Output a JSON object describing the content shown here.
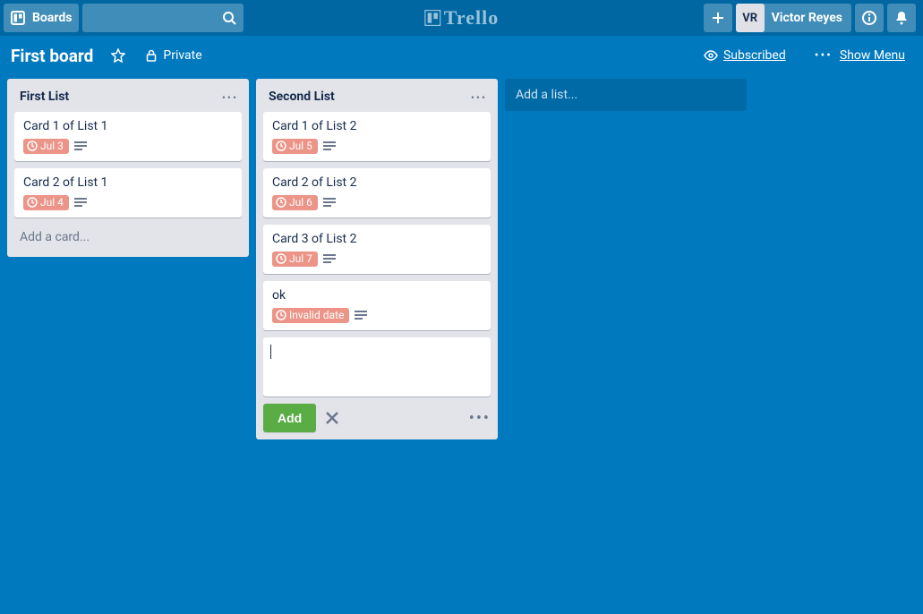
{
  "header": {
    "boards_label": "Boards",
    "logo_text": "Trello",
    "user_initials": "VR",
    "user_name": "Victor Reyes"
  },
  "board": {
    "title": "First board",
    "privacy": "Private",
    "subscribed": "Subscribed",
    "show_menu": "Show Menu"
  },
  "lists": [
    {
      "title": "First List",
      "cards": [
        {
          "title": "Card 1 of List 1",
          "due": "Jul 3"
        },
        {
          "title": "Card 2 of List 1",
          "due": "Jul 4"
        }
      ],
      "add_card_label": "Add a card..."
    },
    {
      "title": "Second List",
      "cards": [
        {
          "title": "Card 1 of List 2",
          "due": "Jul 5"
        },
        {
          "title": "Card 2 of List 2",
          "due": "Jul 6"
        },
        {
          "title": "Card 3 of List 2",
          "due": "Jul 7"
        },
        {
          "title": "ok",
          "due": "Invalid date"
        }
      ],
      "compose": {
        "value": "",
        "add_label": "Add"
      }
    }
  ],
  "add_list_label": "Add a list..."
}
